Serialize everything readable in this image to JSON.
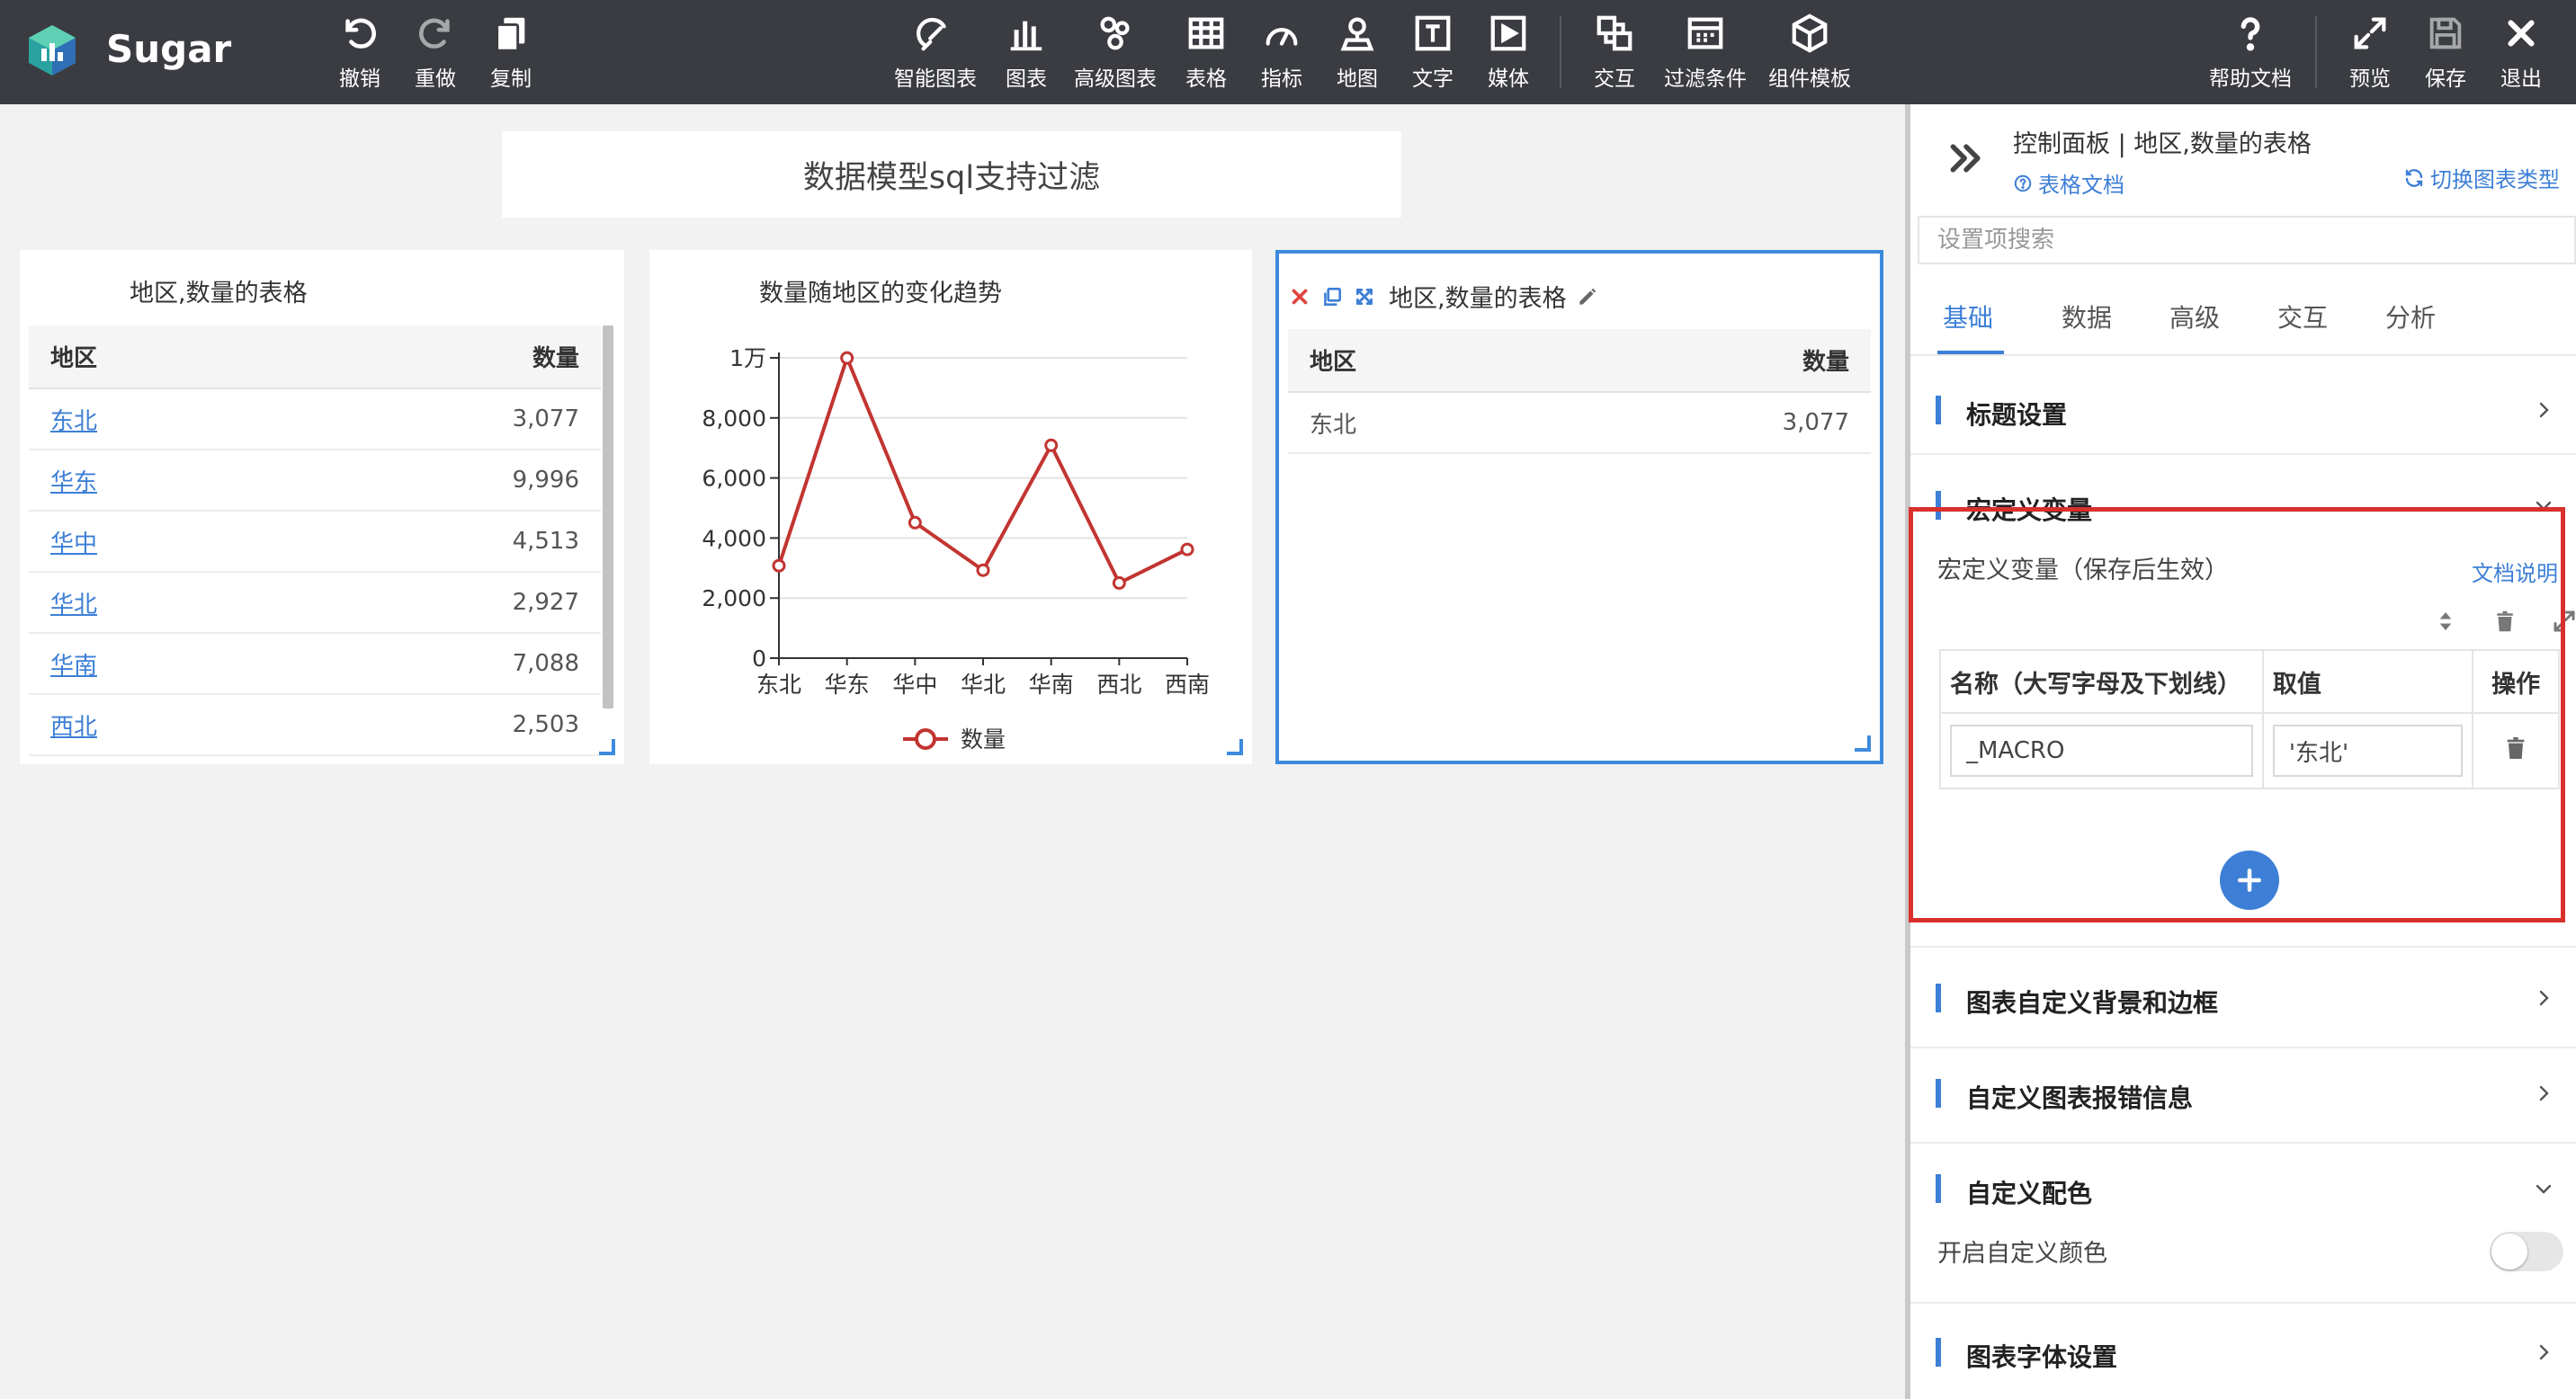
{
  "app": {
    "brand": "Sugar"
  },
  "toolbar": {
    "left": [
      {
        "label": "撤销",
        "icon": "undo-icon"
      },
      {
        "label": "重做",
        "icon": "redo-icon"
      },
      {
        "label": "复制",
        "icon": "copy-icon"
      }
    ],
    "center": [
      {
        "label": "智能图表",
        "icon": "smart-chart-icon"
      },
      {
        "label": "图表",
        "icon": "bar-chart-icon"
      },
      {
        "label": "高级图表",
        "icon": "advanced-chart-icon"
      },
      {
        "label": "表格",
        "icon": "table-icon"
      },
      {
        "label": "指标",
        "icon": "gauge-icon"
      },
      {
        "label": "地图",
        "icon": "map-icon"
      },
      {
        "label": "文字",
        "icon": "text-icon"
      },
      {
        "label": "媒体",
        "icon": "media-icon"
      },
      {
        "label": "交互",
        "icon": "interaction-icon"
      },
      {
        "label": "过滤条件",
        "icon": "filter-icon"
      },
      {
        "label": "组件模板",
        "icon": "template-icon"
      }
    ],
    "right": [
      {
        "label": "帮助文档",
        "icon": "help-icon"
      },
      {
        "label": "预览",
        "icon": "preview-icon"
      },
      {
        "label": "保存",
        "icon": "save-icon"
      },
      {
        "label": "退出",
        "icon": "exit-icon"
      }
    ]
  },
  "page": {
    "title": "数据模型sql支持过滤"
  },
  "table1": {
    "title": "地区,数量的表格",
    "headers": [
      "地区",
      "数量"
    ],
    "rows": [
      [
        "东北",
        "3,077"
      ],
      [
        "华东",
        "9,996"
      ],
      [
        "华中",
        "4,513"
      ],
      [
        "华北",
        "2,927"
      ],
      [
        "华南",
        "7,088"
      ],
      [
        "西北",
        "2,503"
      ]
    ]
  },
  "chart_data": {
    "type": "line",
    "title": "数量随地区的变化趋势",
    "categories": [
      "东北",
      "华东",
      "华中",
      "华北",
      "华南",
      "西北",
      "西南"
    ],
    "series": [
      {
        "name": "数量",
        "values": [
          3077,
          9996,
          4513,
          2927,
          7088,
          2503,
          3620
        ],
        "color": "#c23531"
      }
    ],
    "yticks": [
      "0",
      "2,000",
      "4,000",
      "6,000",
      "8,000",
      "1万"
    ],
    "ylim": [
      0,
      10000
    ],
    "grid": true,
    "legend": "bottom"
  },
  "table2": {
    "title": "地区,数量的表格",
    "headers": [
      "地区",
      "数量"
    ],
    "rows": [
      [
        "东北",
        "3,077"
      ]
    ]
  },
  "panel": {
    "title": "控制面板 | 地区,数量的表格",
    "doc_link": "表格文档",
    "switch_link": "切换图表类型",
    "search_placeholder": "设置项搜索",
    "tabs": [
      "基础",
      "数据",
      "高级",
      "交互",
      "分析"
    ],
    "active_tab": "基础",
    "sections": {
      "title_settings": "标题设置",
      "macro": "宏定义变量",
      "bg_border": "图表自定义背景和边框",
      "error_info": "自定义图表报错信息",
      "color": "自定义配色",
      "font": "图表字体设置"
    },
    "macro": {
      "desc": "宏定义变量（保存后生效）",
      "doc": "文档说明",
      "headers": [
        "名称（大写字母及下划线）",
        "取值",
        "操作"
      ],
      "name_value": "_MACRO",
      "val_value": "'东北'"
    },
    "color": {
      "toggle_label": "开启自定义颜色",
      "enabled": false
    },
    "accent": "#3d7fd6",
    "highlight_color": "#d9302c"
  }
}
